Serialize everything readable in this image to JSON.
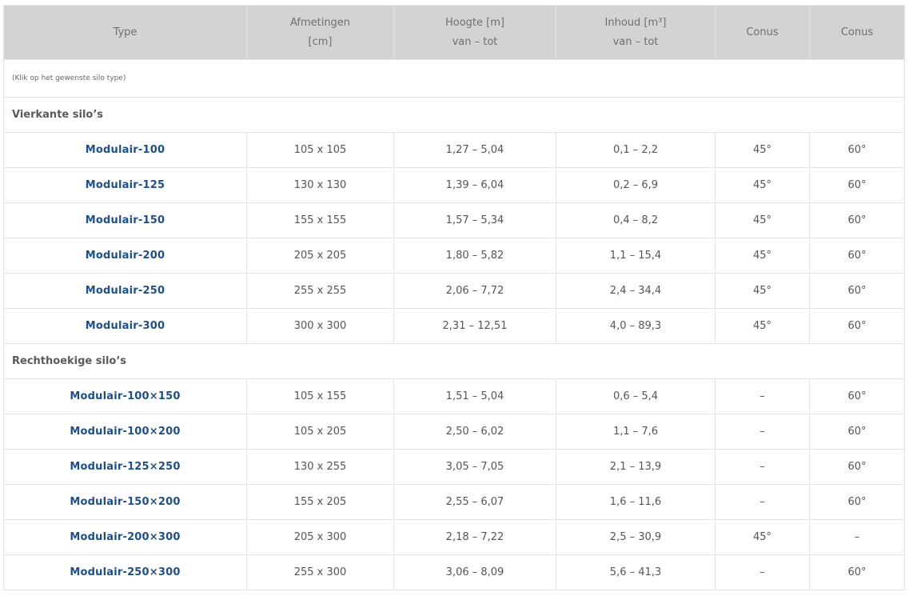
{
  "headers": [
    {
      "line1": "Type",
      "line2": ""
    },
    {
      "line1": "Afmetingen",
      "line2": "[cm]"
    },
    {
      "line1": "Hoogte [m]",
      "line2": "van – tot"
    },
    {
      "line1": "Inhoud [m³]",
      "line2": "van – tot"
    },
    {
      "line1": "Conus",
      "line2": ""
    },
    {
      "line1": "Conus",
      "line2": ""
    }
  ],
  "note": "(Klik op het gewenste silo type)",
  "sections": [
    {
      "title": "Vierkante silo’s",
      "rows": [
        {
          "type": "Modulair-100",
          "afmetingen": "105 x 105",
          "hoogte": "1,27 – 5,04",
          "inhoud": "0,1 – 2,2",
          "conus1": "45°",
          "conus2": "60°"
        },
        {
          "type": "Modulair-125",
          "afmetingen": "130 x 130",
          "hoogte": "1,39 – 6,04",
          "inhoud": "0,2 – 6,9",
          "conus1": "45°",
          "conus2": "60°"
        },
        {
          "type": "Modulair-150",
          "afmetingen": "155 x 155",
          "hoogte": "1,57 – 5,34",
          "inhoud": "0,4 – 8,2",
          "conus1": "45°",
          "conus2": "60°"
        },
        {
          "type": "Modulair-200",
          "afmetingen": "205 x 205",
          "hoogte": "1,80 – 5,82",
          "inhoud": "1,1 – 15,4",
          "conus1": "45°",
          "conus2": "60°"
        },
        {
          "type": "Modulair-250",
          "afmetingen": "255 x 255",
          "hoogte": "2,06 – 7,72",
          "inhoud": "2,4 – 34,4",
          "conus1": "45°",
          "conus2": "60°"
        },
        {
          "type": "Modulair-300",
          "afmetingen": "300 x 300",
          "hoogte": "2,31 – 12,51",
          "inhoud": "4,0 – 89,3",
          "conus1": "45°",
          "conus2": "60°"
        }
      ]
    },
    {
      "title": "Rechthoekige silo’s",
      "rows": [
        {
          "type": "Modulair-100×150",
          "afmetingen": "105 x 155",
          "hoogte": "1,51 – 5,04",
          "inhoud": "0,6 – 5,4",
          "conus1": "–",
          "conus2": "60°"
        },
        {
          "type": "Modulair-100×200",
          "afmetingen": "105 x 205",
          "hoogte": "2,50 – 6,02",
          "inhoud": "1,1 – 7,6",
          "conus1": "–",
          "conus2": "60°"
        },
        {
          "type": "Modulair-125×250",
          "afmetingen": "130 x 255",
          "hoogte": "3,05 – 7,05",
          "inhoud": "2,1 – 13,9",
          "conus1": "–",
          "conus2": "60°"
        },
        {
          "type": "Modulair-150×200",
          "afmetingen": "155 x 205",
          "hoogte": "2,55 – 6,07",
          "inhoud": "1,6 – 11,6",
          "conus1": "–",
          "conus2": "60°"
        },
        {
          "type": "Modulair-200×300",
          "afmetingen": "205 x 300",
          "hoogte": "2,18 – 7,22",
          "inhoud": "2,5 – 30,9",
          "conus1": "45°",
          "conus2": "–"
        },
        {
          "type": "Modulair-250×300",
          "afmetingen": "255 x 300",
          "hoogte": "3,06 – 8,09",
          "inhoud": "5,6 – 41,3",
          "conus1": "–",
          "conus2": "60°"
        }
      ]
    }
  ],
  "colors": {
    "header_bg": "#d3d3d3",
    "link": "#1f4f86",
    "border": "#e3e3e3"
  }
}
